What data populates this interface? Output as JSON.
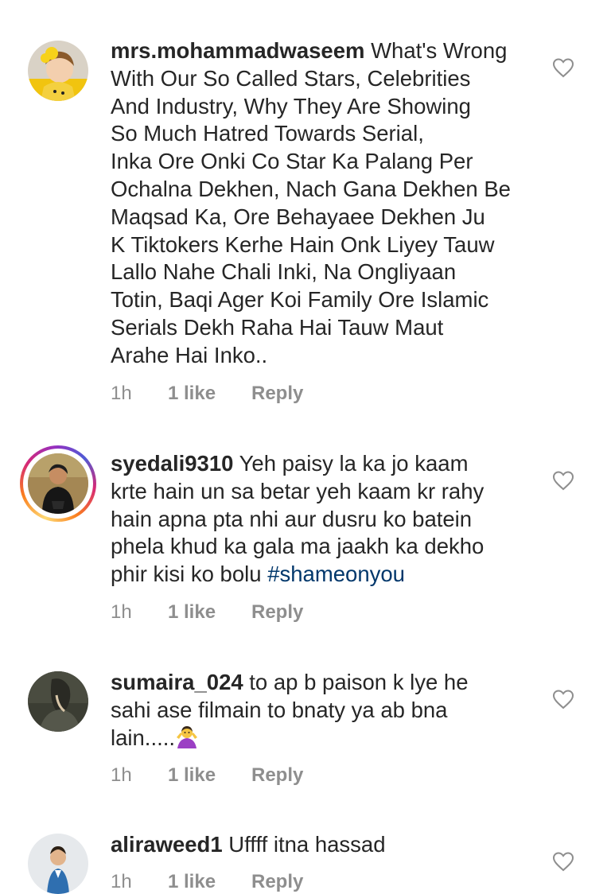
{
  "comments": [
    {
      "username": "mrs.mohammadwaseem",
      "text": " What's Wrong\nWith Our So Called Stars, Celebrities\nAnd Industry, Why They Are Showing\nSo Much Hatred Towards Serial,\nInka Ore Onki Co Star Ka Palang Per\nOchalna Dekhen, Nach Gana Dekhen Be\nMaqsad Ka, Ore Behayaee Dekhen Ju\nK Tiktokers Kerhe Hain Onk Liyey Tauw\nLallo Nahe Chali Inki, Na Ongliyaan\nTotin, Baqi Ager Koi Family Ore Islamic\nSerials Dekh Raha Hai Tauw Maut\nArahe Hai Inko..",
      "time": "1h",
      "likes": "1 like",
      "reply": "Reply"
    },
    {
      "username": "syedali9310",
      "text": " Yeh paisy la ka jo kaam\nkrte hain un sa betar yeh kaam kr rahy\nhain apna pta nhi aur dusru ko batein\nphela khud ka gala ma jaakh ka dekho\nphir kisi ko bolu ",
      "hashtag": "#shameonyou",
      "time": "1h",
      "likes": "1 like",
      "reply": "Reply"
    },
    {
      "username": "sumaira_024",
      "text": " to ap b paison k lye he\nsahi ase filmain to bnaty ya ab bna\nlain.....",
      "time": "1h",
      "likes": "1 like",
      "reply": "Reply"
    },
    {
      "username": "aliraweed1",
      "text": " Uffff itna hassad",
      "time": "1h",
      "likes": "1 like",
      "reply": "Reply"
    }
  ],
  "colors": {
    "text": "#262626",
    "meta": "#8e8e8e",
    "hashtag": "#00376b",
    "heart_outline": "#8e8e8e"
  },
  "icons": {
    "like": "heart-outline-icon",
    "emoji": "person-shrugging-emoji"
  }
}
